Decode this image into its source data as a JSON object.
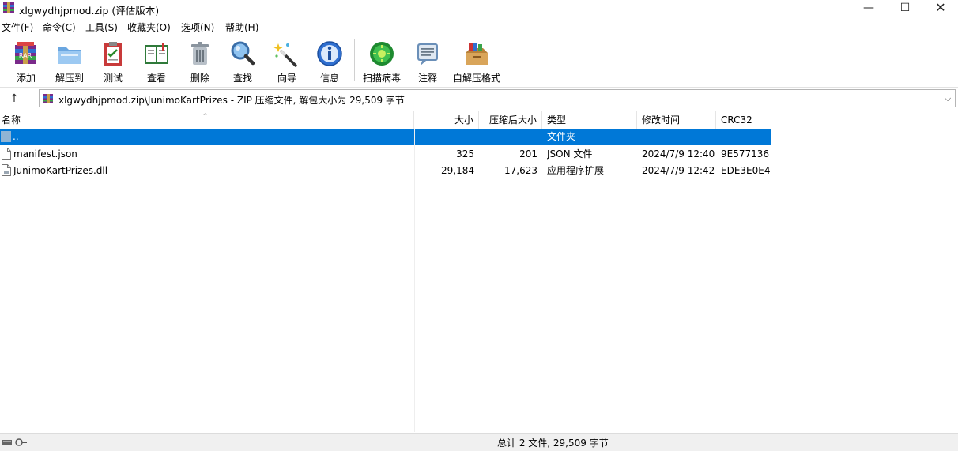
{
  "window": {
    "title": "xlgwydhjpmod.zip (评估版本)",
    "min_glyph": "—",
    "max_glyph": "☐",
    "close_glyph": "✕"
  },
  "menu": [
    "文件(F)",
    "命令(C)",
    "工具(S)",
    "收藏夹(O)",
    "选项(N)",
    "帮助(H)"
  ],
  "toolbar": {
    "buttons": [
      {
        "label": "添加",
        "icon": "add-archive-icon"
      },
      {
        "label": "解压到",
        "icon": "extract-folder-icon"
      },
      {
        "label": "测试",
        "icon": "test-clipboard-icon"
      },
      {
        "label": "查看",
        "icon": "view-book-icon"
      },
      {
        "label": "删除",
        "icon": "trash-icon"
      },
      {
        "label": "查找",
        "icon": "magnifier-icon"
      },
      {
        "label": "向导",
        "icon": "wizard-wand-icon"
      },
      {
        "label": "信息",
        "icon": "info-icon"
      },
      {
        "label": "扫描病毒",
        "icon": "virus-scan-icon"
      },
      {
        "label": "注释",
        "icon": "comment-icon"
      },
      {
        "label": "自解压格式",
        "icon": "sfx-box-icon"
      }
    ]
  },
  "address": {
    "up_glyph": "↑",
    "text": "xlgwydhjpmod.zip\\JunimoKartPrizes - ZIP 压缩文件, 解包大小为 29,509 字节",
    "drop_glyph": "⌵"
  },
  "list": {
    "columns": [
      "名称",
      "大小",
      "压缩后大小",
      "类型",
      "修改时间",
      "CRC32"
    ],
    "rows": [
      {
        "name": "..",
        "size": "",
        "packed": "",
        "type": "文件夹",
        "modified": "",
        "crc": "",
        "selected": true,
        "kind": "folder"
      },
      {
        "name": "manifest.json",
        "size": "325",
        "packed": "201",
        "type": "JSON 文件",
        "modified": "2024/7/9 12:40",
        "crc": "9E577136",
        "selected": false,
        "kind": "file"
      },
      {
        "name": "JunimoKartPrizes.dll",
        "size": "29,184",
        "packed": "17,623",
        "type": "应用程序扩展",
        "modified": "2024/7/9 12:42",
        "crc": "EDE3E0E4",
        "selected": false,
        "kind": "dll"
      }
    ]
  },
  "status": {
    "text": "总计 2 文件, 29,509 字节"
  },
  "colors": {
    "selection": "#0078d7"
  }
}
